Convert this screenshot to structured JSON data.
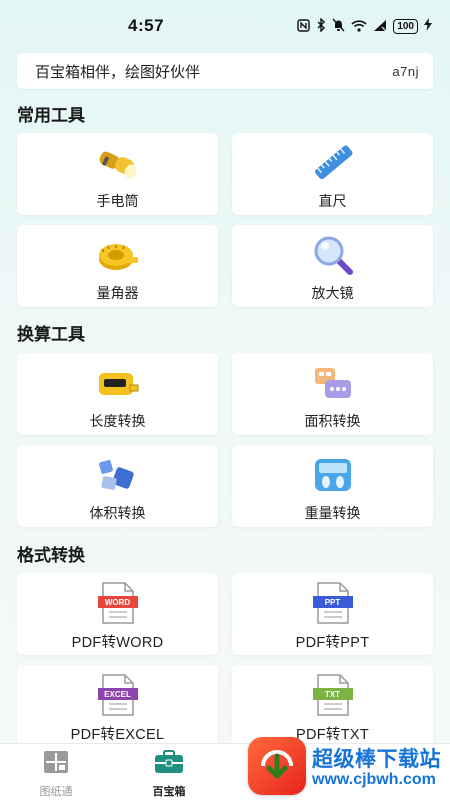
{
  "status": {
    "time": "4:57",
    "battery": "100"
  },
  "banner": {
    "text": "百宝箱相伴，绘图好伙伴",
    "code": "a7nj"
  },
  "sections": {
    "common": "常用工具",
    "convert": "换算工具",
    "format": "格式转换"
  },
  "common_tools": [
    {
      "label": "手电筒",
      "icon": "flashlight-icon"
    },
    {
      "label": "直尺",
      "icon": "ruler-icon"
    },
    {
      "label": "量角器",
      "icon": "tape-measure-icon"
    },
    {
      "label": "放大镜",
      "icon": "magnifier-icon"
    }
  ],
  "convert_tools": [
    {
      "label": "长度转换",
      "icon": "length-icon"
    },
    {
      "label": "面积转换",
      "icon": "area-icon"
    },
    {
      "label": "体积转换",
      "icon": "volume-icon"
    },
    {
      "label": "重量转换",
      "icon": "weight-icon"
    }
  ],
  "format_tools": [
    {
      "label": "PDF转WORD",
      "badge": "WORD",
      "color": "#e8453c"
    },
    {
      "label": "PDF转PPT",
      "badge": "PPT",
      "color": "#3b5bdb"
    },
    {
      "label": "PDF转EXCEL",
      "badge": "EXCEL",
      "color": "#8e44ad"
    },
    {
      "label": "PDF转TXT",
      "badge": "TXT",
      "color": "#7cb342"
    }
  ],
  "tabbar": {
    "tabs": [
      {
        "label": "图纸通",
        "active": false
      },
      {
        "label": "百宝箱",
        "active": true
      }
    ]
  },
  "watermark": {
    "title": "超级棒下载站",
    "url": "www.cjbwh.com"
  }
}
